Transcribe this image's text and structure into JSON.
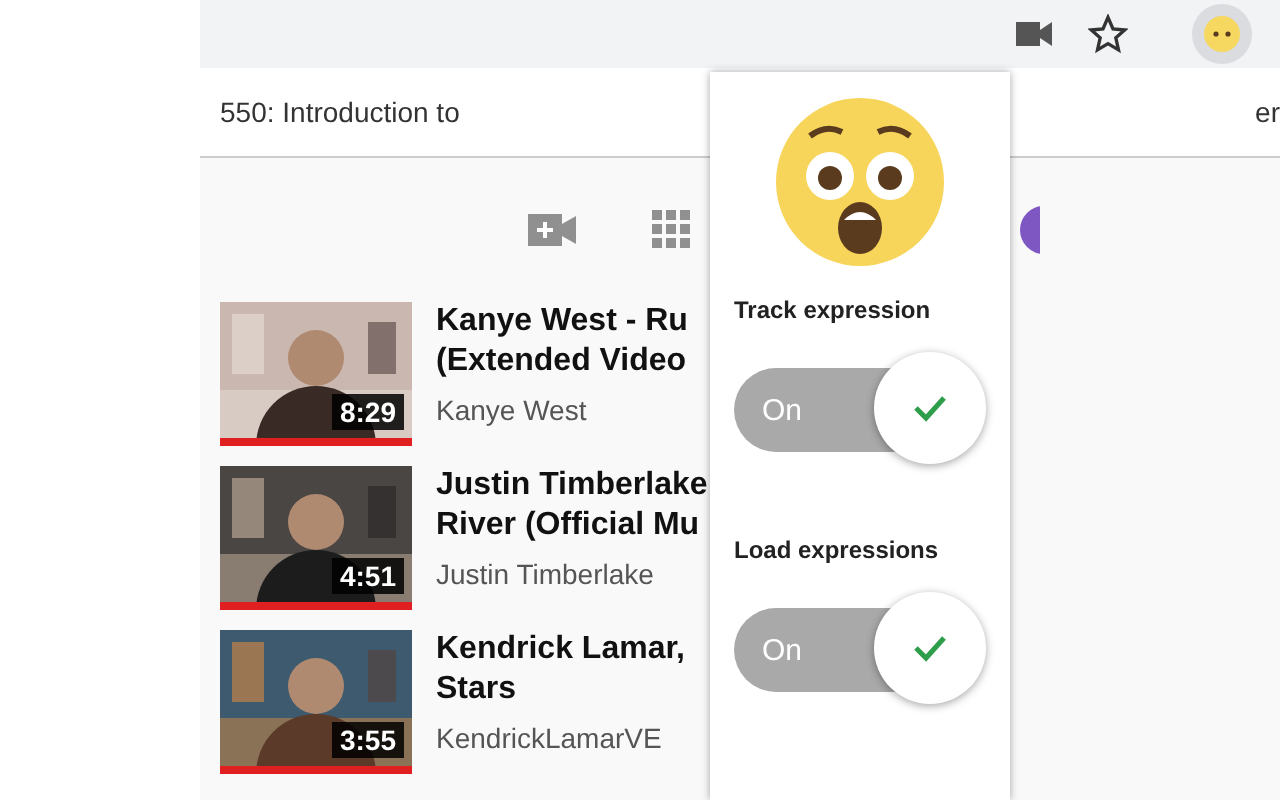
{
  "bookmark_bar": {
    "items": [
      "550: Introduction to",
      "er"
    ]
  },
  "popup": {
    "toggles": [
      {
        "label": "Track expression",
        "state_text": "On",
        "on": true
      },
      {
        "label": "Load expressions",
        "state_text": "On",
        "on": true
      }
    ]
  },
  "videos": [
    {
      "title_lines": [
        "Kanye West - Ru",
        "(Extended Video"
      ],
      "channel": "Kanye West",
      "duration": "8:29",
      "level": 1
    },
    {
      "title_lines": [
        "Justin Timberlake",
        "River (Official Mu"
      ],
      "channel": "Justin Timberlake",
      "duration": "4:51",
      "level": 1
    },
    {
      "title_lines": [
        "Kendrick Lamar,",
        "Stars"
      ],
      "channel": "KendrickLamarVE",
      "duration": "3:55",
      "level": 1
    }
  ]
}
